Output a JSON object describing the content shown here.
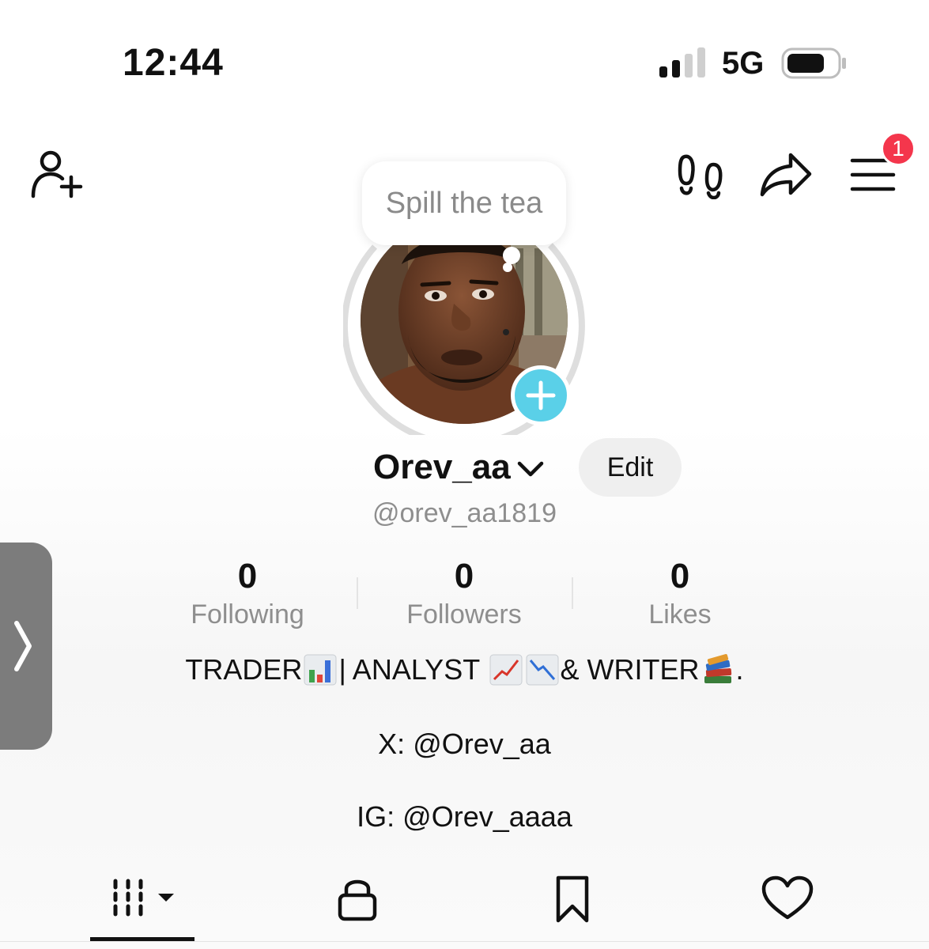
{
  "status_bar": {
    "time": "12:44",
    "network": "5G",
    "signal_bars_filled": 2,
    "battery_level": 0.7
  },
  "top_nav": {
    "add_user_icon": "person-plus-icon",
    "footprints_icon": "footprints-icon",
    "share_icon": "share-arrow-icon",
    "menu_icon": "hamburger-menu-icon",
    "menu_badge_count": "1"
  },
  "profile": {
    "note_text": "Spill the tea",
    "display_name": "Orev_aa",
    "edit_label": "Edit",
    "username": "@orev_aa1819",
    "stats": [
      {
        "value": "0",
        "label": "Following"
      },
      {
        "value": "0",
        "label": "Followers"
      },
      {
        "value": "0",
        "label": "Likes"
      }
    ],
    "bio": {
      "line1_a": "TRADER",
      "line1_b": "| ANALYST ",
      "line1_c": "& WRITER",
      "line1_d": ".",
      "line2": "X: @Orev_aa",
      "line3": "IG:  @Orev_aaaa"
    }
  },
  "tabs": [
    {
      "name": "videos",
      "icon": "grid-bars-icon",
      "active": true
    },
    {
      "name": "private",
      "icon": "lock-icon",
      "active": false
    },
    {
      "name": "saved",
      "icon": "bookmark-icon",
      "active": false
    },
    {
      "name": "liked",
      "icon": "heart-icon",
      "active": false
    }
  ],
  "colors": {
    "badge": "#f4364c",
    "add_story": "#5ad0e8",
    "secondary_text": "#8e8e8e",
    "drawer": "#7c7c7c"
  }
}
